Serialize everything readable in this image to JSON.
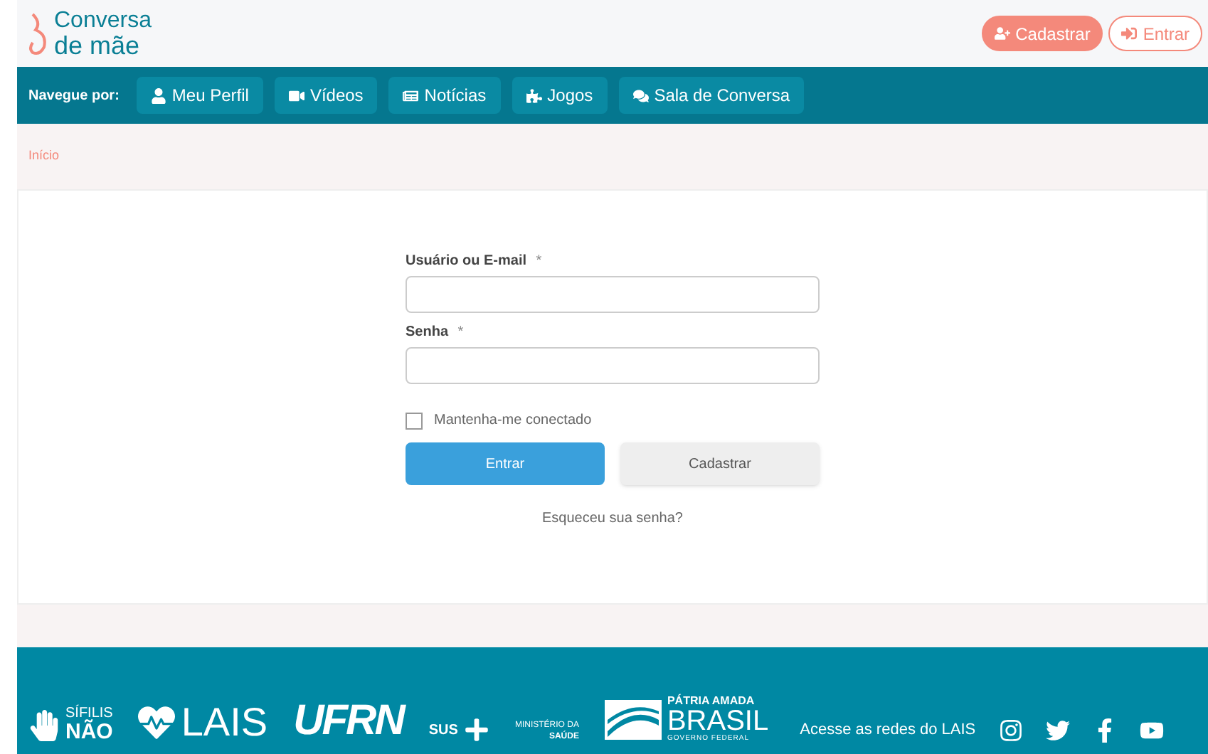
{
  "logo": {
    "line_1": "Conversa",
    "line_2": "de mãe"
  },
  "header_buttons": [
    {
      "label": "Cadastrar",
      "kind": "register",
      "selected": true
    },
    {
      "label": "Entrar",
      "kind": "login",
      "selected": false
    }
  ],
  "nav": {
    "label": "Navegue por:",
    "items": [
      {
        "label": "Meu Perfil",
        "kind": "user"
      },
      {
        "label": "Vídeos",
        "kind": "video"
      },
      {
        "label": "Notícias",
        "kind": "news"
      },
      {
        "label": "Jogos",
        "kind": "puzzle"
      },
      {
        "label": "Sala de Conversa",
        "kind": "chat"
      }
    ]
  },
  "breadcrumb": "Início",
  "form": {
    "fields": [
      {
        "label": "Usuário ou E-mail",
        "required": "*"
      },
      {
        "label": "Senha",
        "required": "*"
      }
    ],
    "remember": {
      "label": "Mantenha-me conectado",
      "checked": false
    },
    "buttons": [
      {
        "label": "Entrar",
        "kind": "primary"
      },
      {
        "label": "Cadastrar",
        "kind": "secondary"
      }
    ],
    "forgot": "Esqueceu sua senha?"
  },
  "footer": {
    "logos": [
      {
        "kind": "sifilis",
        "lines": [
          "SÍFILIS",
          "NÃO"
        ]
      },
      {
        "kind": "lais",
        "lines": [
          "LAIS"
        ]
      },
      {
        "kind": "ufrn",
        "lines": [
          "UFRN"
        ]
      },
      {
        "kind": "sus",
        "lines": [
          "SUS"
        ]
      },
      {
        "kind": "ministerio",
        "lines": [
          "MINISTÉRIO DA",
          "SAÚDE"
        ]
      },
      {
        "kind": "brasil",
        "lines": [
          "PÁTRIA AMADA",
          "BRASIL",
          "GOVERNO FEDERAL"
        ]
      }
    ],
    "social_label": "Acesse as redes do LAIS",
    "social": [
      {
        "kind": "instagram"
      },
      {
        "kind": "twitter"
      },
      {
        "kind": "facebook"
      },
      {
        "kind": "youtube"
      }
    ]
  }
}
